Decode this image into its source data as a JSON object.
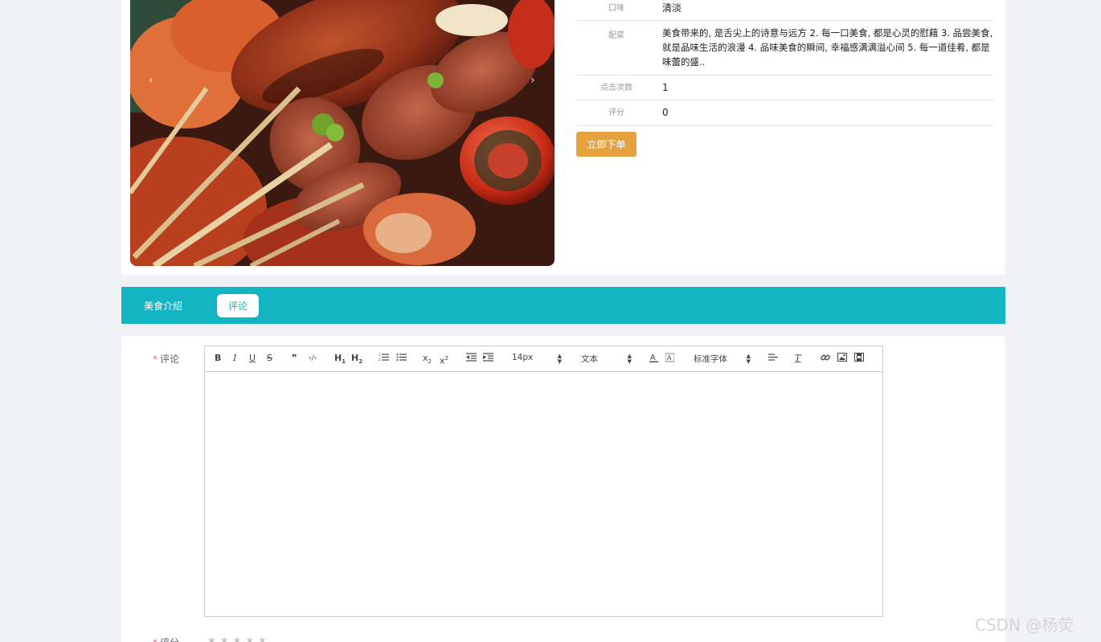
{
  "food": {
    "image_alt": "烤串美食图",
    "details": [
      {
        "label": "口味",
        "value": "清淡"
      },
      {
        "label": "配菜",
        "value": "美食带来的, 是舌尖上的诗意与远方 2. 每一口美食, 都是心灵的慰藉 3. 品尝美食, 就是品味生活的浪漫 4. 品味美食的瞬间, 幸福感满满溢心间 5. 每一道佳肴, 都是味蕾的盛.."
      },
      {
        "label": "点击次数",
        "value": "1"
      },
      {
        "label": "评分",
        "value": "0"
      }
    ],
    "order_button": "立即下单",
    "carousel_prev": "‹",
    "carousel_next": "›"
  },
  "tabs": [
    {
      "label": "美食介绍",
      "active": false
    },
    {
      "label": "评论",
      "active": true
    }
  ],
  "comment_form": {
    "comment_label": "评论",
    "required_mark": "*",
    "rating_label": "评分",
    "rating_stars": 5,
    "rating_value": 0,
    "stars_text": "★★★★★",
    "editor": {
      "toolbar": {
        "bold": "B",
        "italic": "I",
        "underline": "U",
        "strike": "S",
        "quote": "❞",
        "code": "‹/›",
        "h1": "H",
        "h1_sub": "1",
        "h2": "H",
        "h2_sub": "2",
        "sub": "x",
        "sub_mark": "2",
        "sup": "x",
        "sup_mark": "2",
        "size": "14px",
        "header": "文本",
        "font": "标准字体",
        "clean": "T"
      },
      "content": ""
    }
  },
  "watermark": "CSDN @杨荧",
  "colors": {
    "accent": "#13b5c2",
    "order_button": "#e6a23c",
    "background": "#f0f2f5"
  }
}
